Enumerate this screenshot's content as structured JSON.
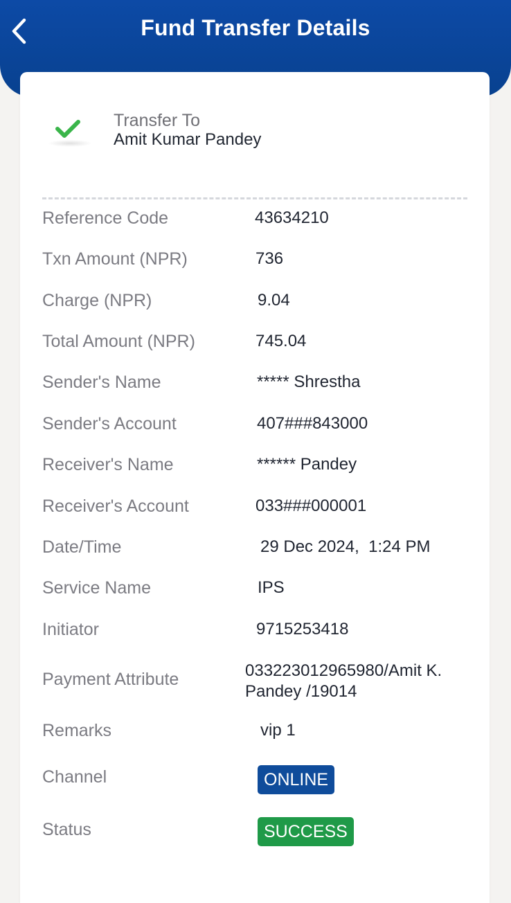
{
  "header": {
    "title": "Fund Transfer Details"
  },
  "transfer": {
    "label": "Transfer To",
    "name": "Amit Kumar Pandey"
  },
  "details": [
    {
      "label": "Reference Code",
      "value": "43634210"
    },
    {
      "label": "Txn Amount (NPR)",
      "value": "736"
    },
    {
      "label": "Charge (NPR)",
      "value": "9.04"
    },
    {
      "label": "Total Amount (NPR)",
      "value": "745.04"
    },
    {
      "label": "Sender's Name",
      "value": "***** Shrestha"
    },
    {
      "label": "Sender's Account",
      "value": "407###843000"
    },
    {
      "label": "Receiver's Name",
      "value": "****** Pandey"
    },
    {
      "label": "Receiver's Account",
      "value": "033###000001"
    },
    {
      "label": "Date/Time",
      "value": "29 Dec 2024,  1:24 PM"
    },
    {
      "label": "Service Name",
      "value": "IPS"
    },
    {
      "label": "Initiator",
      "value": "9715253418"
    },
    {
      "label": "Payment Attribute",
      "value": "033223012965980/Amit K. Pandey /19014"
    },
    {
      "label": "Remarks",
      "value": "vip 1"
    },
    {
      "label": "Channel",
      "value": "ONLINE"
    },
    {
      "label": "Status",
      "value": "SUCCESS"
    }
  ],
  "colors": {
    "header_blue": "#0d4aa6",
    "check_green": "#3ab54a",
    "channel_badge": "#0f4c9b",
    "status_badge": "#1f9a48"
  },
  "icons": {
    "back": "chevron-left-icon",
    "success": "checkmark-icon"
  }
}
